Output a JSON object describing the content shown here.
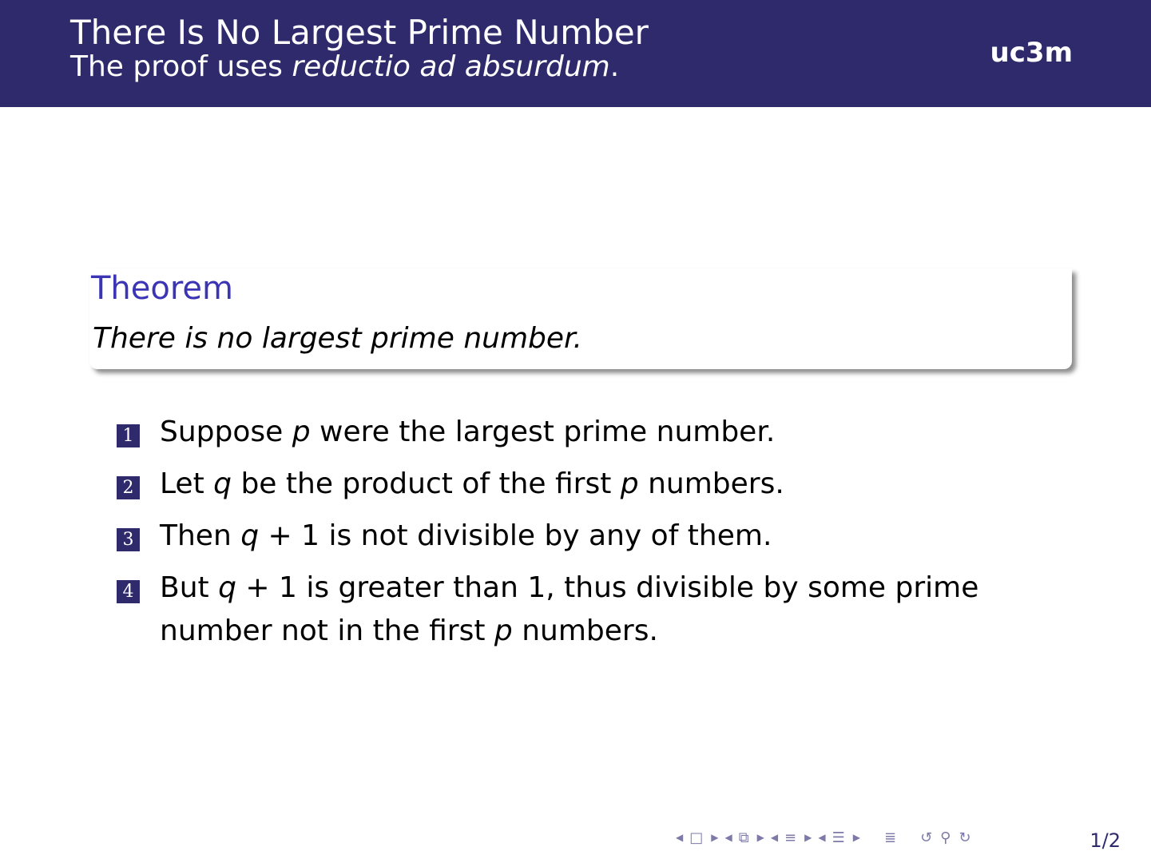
{
  "header": {
    "title": "There Is No Largest Prime Number",
    "subtitle_prefix": "The proof uses ",
    "subtitle_emph": "reductio ad absurdum",
    "subtitle_suffix": ".",
    "logo": "uc3m"
  },
  "theorem": {
    "title": "Theorem",
    "body": "There is no largest prime number."
  },
  "steps": [
    {
      "num": "1",
      "parts": [
        "Suppose ",
        "p",
        " were the largest prime number."
      ]
    },
    {
      "num": "2",
      "parts": [
        "Let ",
        "q",
        " be the product of the first ",
        "p",
        " numbers."
      ]
    },
    {
      "num": "3",
      "parts": [
        "Then ",
        "q",
        " + 1 is not divisible by any of them."
      ]
    },
    {
      "num": "4",
      "parts": [
        "But ",
        "q",
        " + 1 is greater than 1, thus divisible by some prime number not in the first ",
        "p",
        " numbers."
      ]
    }
  ],
  "footer": {
    "page": "1/2",
    "nav_icons": [
      "prev-frame-icon",
      "frame-icon",
      "next-frame-icon",
      "prev-subsection-icon",
      "subsection-icon",
      "next-subsection-icon",
      "prev-section-icon",
      "section-icon",
      "next-section-icon",
      "prev-slide-icon",
      "slide-icon",
      "next-slide-icon",
      "outline-icon",
      "undo-icon",
      "search-icon",
      "redo-icon"
    ]
  },
  "colors": {
    "header_bg": "#2e2a6b",
    "theorem_title": "#3b35b5"
  }
}
